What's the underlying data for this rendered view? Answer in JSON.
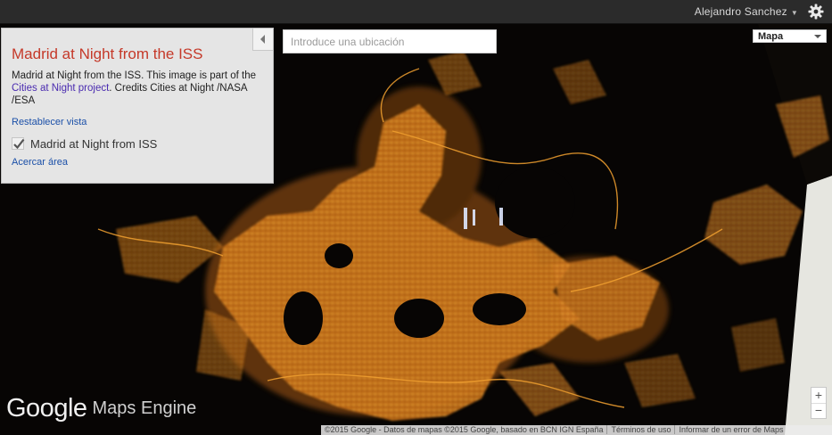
{
  "topbar": {
    "user_name": "Alejandro Sanchez",
    "settings_icon": "gear-icon"
  },
  "panel": {
    "title": "Madrid at Night from the ISS",
    "description_prefix": "Madrid at Night from the ISS. This image is part of the ",
    "description_link": "Cities at Night project",
    "description_suffix": ". Credits Cities at Night /NASA /ESA",
    "reset_view": "Restablecer vista",
    "layer_label": "Madrid at Night from ISS",
    "layer_checked": true,
    "zoom_area": "Acercar área",
    "collapse_icon": "triangle-left-icon"
  },
  "search": {
    "placeholder": "Introduce una ubicación",
    "value": ""
  },
  "map_type": {
    "selected": "Mapa"
  },
  "zoom": {
    "plus": "+",
    "minus": "−"
  },
  "logo": {
    "google": "Google",
    "product": "Maps Engine"
  },
  "footer": {
    "attribution": "©2015 Google - Datos de mapas ©2015 Google, basado en BCN IGN España",
    "terms": "Términos de uso",
    "report": "Informar de un error de Maps"
  },
  "colors": {
    "topbar": "#2b2b2b",
    "panel_bg": "#e5e5e5",
    "title": "#c53929",
    "link": "#1a4fa8",
    "city_lights": "#d07a1a"
  }
}
